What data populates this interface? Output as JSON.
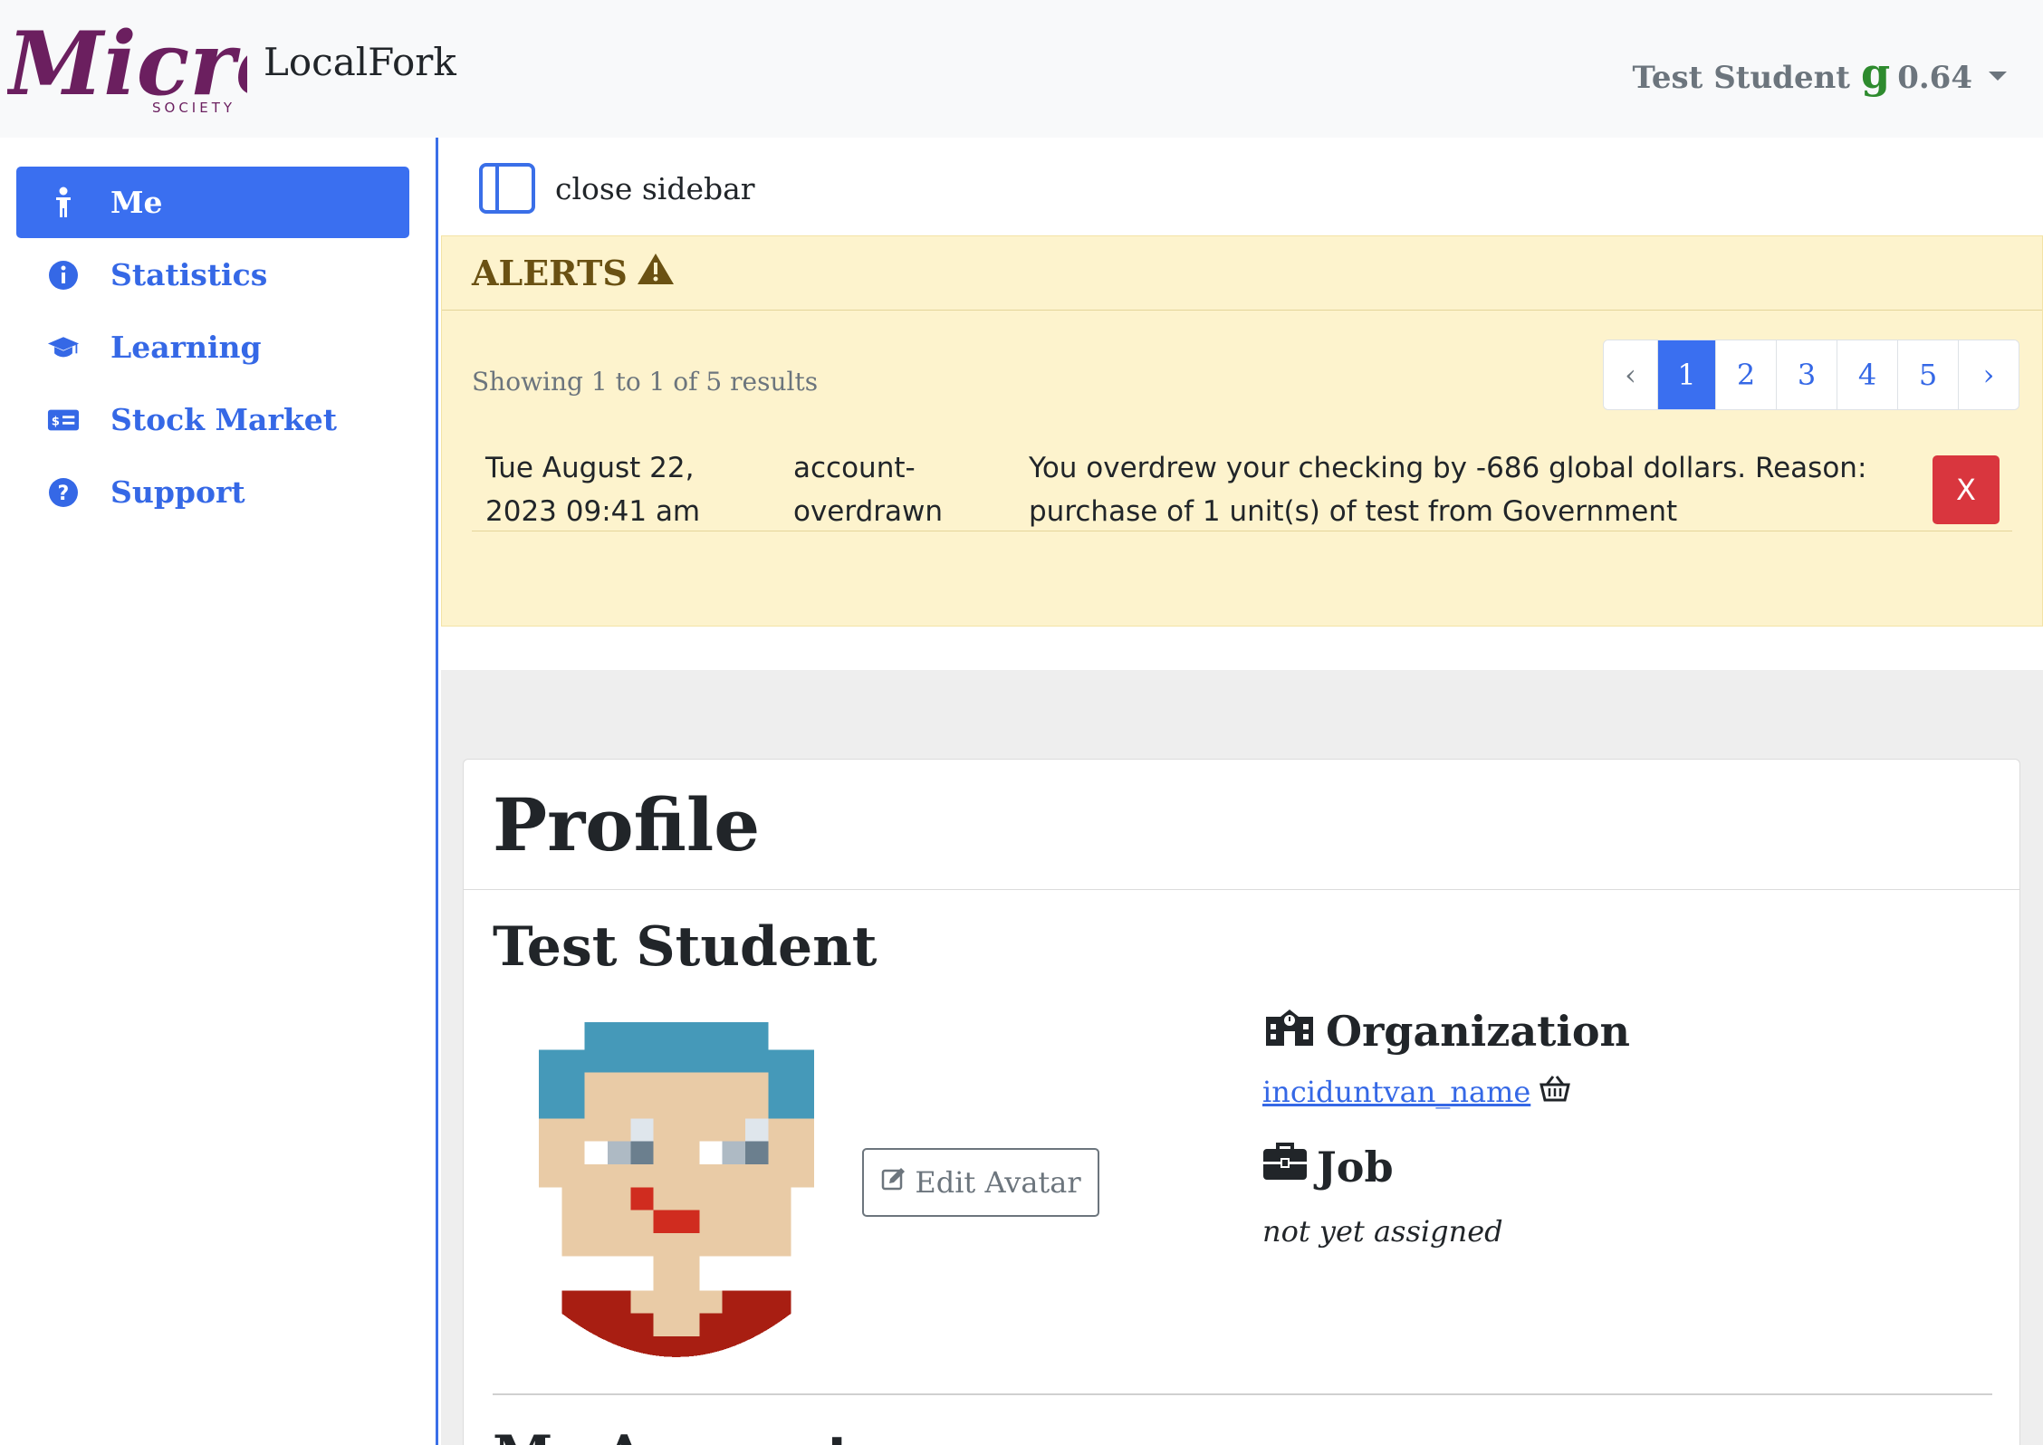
{
  "header": {
    "logo_text": "Micro",
    "logo_subtext": "SOCIETY",
    "brand": "LocalFork",
    "user_name": "Test Student",
    "currency_symbol": "g",
    "balance": "0.64"
  },
  "sidebar": {
    "items": [
      {
        "label": "Me",
        "icon": "person-icon",
        "active": true
      },
      {
        "label": "Statistics",
        "icon": "info-icon",
        "active": false
      },
      {
        "label": "Learning",
        "icon": "graduation-cap-icon",
        "active": false
      },
      {
        "label": "Stock Market",
        "icon": "money-card-icon",
        "active": false
      },
      {
        "label": "Support",
        "icon": "question-icon",
        "active": false
      }
    ]
  },
  "main": {
    "close_sidebar_label": "close sidebar",
    "alerts": {
      "title": "ALERTS",
      "showing": "Showing 1 to 1 of 5 results",
      "pagination": {
        "prev": "‹",
        "pages": [
          "1",
          "2",
          "3",
          "4",
          "5"
        ],
        "next": "›",
        "current": "1"
      },
      "rows": [
        {
          "date": "Tue August 22, 2023 09:41 am",
          "type": "account-overdrawn",
          "message": "You overdrew your checking by -686 global dollars. Reason: purchase of 1 unit(s) of test from Government",
          "dismiss_label": "X"
        }
      ]
    },
    "profile": {
      "title": "Profile",
      "name": "Test Student",
      "edit_avatar_label": "Edit Avatar",
      "organization_heading": "Organization",
      "organization_name": "inciduntvan_name",
      "job_heading": "Job",
      "job_value": "not yet assigned",
      "next_section_heading": "My Account"
    }
  },
  "colors": {
    "primary": "#3a6ff0",
    "alert_bg": "#fdf3cd",
    "danger": "#d9363e",
    "logo": "#6b1f5f",
    "currency": "#2e8b2e"
  }
}
